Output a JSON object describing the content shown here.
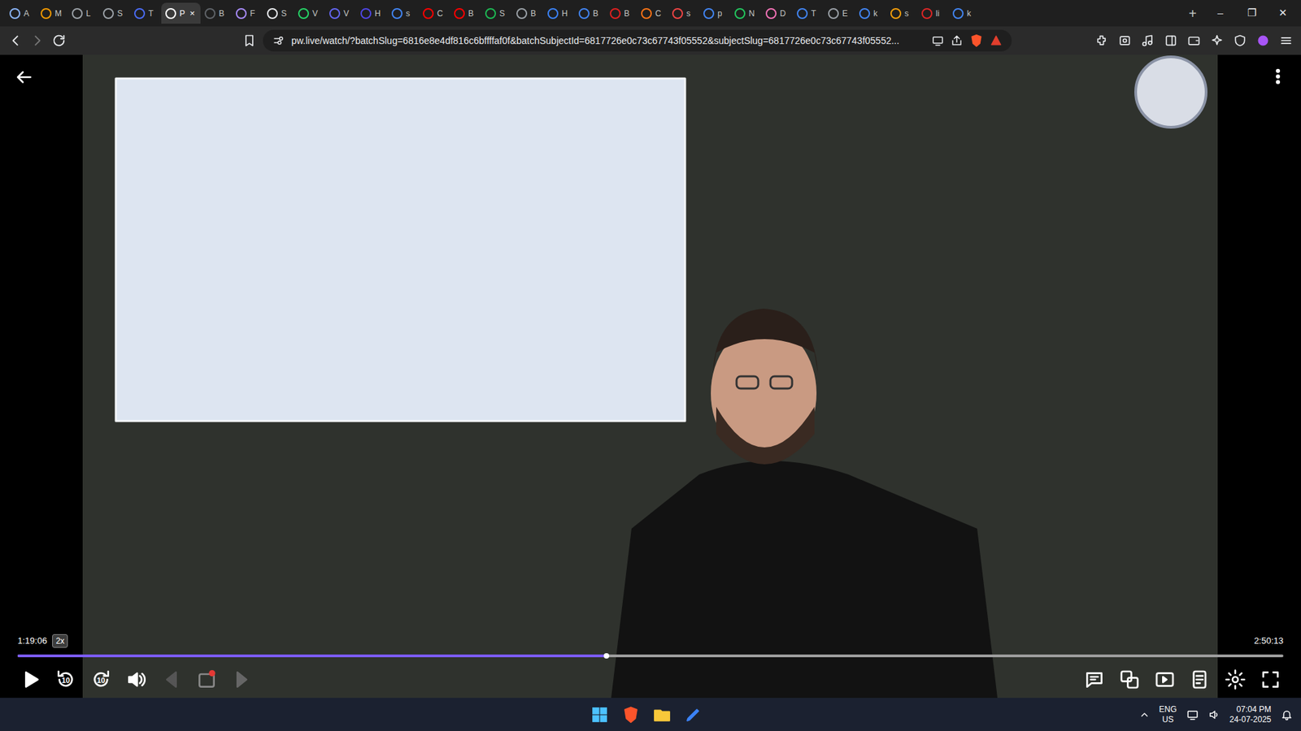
{
  "tabs": [
    {
      "label": "A",
      "selected": false,
      "color": "#8ab4f8"
    },
    {
      "label": "M",
      "selected": false,
      "color": "#f29900"
    },
    {
      "label": "L",
      "selected": false,
      "color": "#9aa0a6"
    },
    {
      "label": "S",
      "selected": false,
      "color": "#9aa0a6"
    },
    {
      "label": "T",
      "selected": false,
      "color": "#4a6cf7"
    },
    {
      "label": "P",
      "selected": true,
      "color": "#ffffff"
    },
    {
      "label": "B",
      "selected": false,
      "color": "#5f6368"
    },
    {
      "label": "F",
      "selected": false,
      "color": "#a78bfa"
    },
    {
      "label": "S",
      "selected": false,
      "color": "#e8eaed"
    },
    {
      "label": "V",
      "selected": false,
      "color": "#25d366"
    },
    {
      "label": "V",
      "selected": false,
      "color": "#6366f1"
    },
    {
      "label": "H",
      "selected": false,
      "color": "#4f46e5"
    },
    {
      "label": "s",
      "selected": false,
      "color": "#4285f4"
    },
    {
      "label": "C",
      "selected": false,
      "color": "#ff0000"
    },
    {
      "label": "B",
      "selected": false,
      "color": "#ff0000"
    },
    {
      "label": "S",
      "selected": false,
      "color": "#1db954"
    },
    {
      "label": "B",
      "selected": false,
      "color": "#9aa0a6"
    },
    {
      "label": "H",
      "selected": false,
      "color": "#3b82f6"
    },
    {
      "label": "B",
      "selected": false,
      "color": "#4285f4"
    },
    {
      "label": "B",
      "selected": false,
      "color": "#e02020"
    },
    {
      "label": "C",
      "selected": false,
      "color": "#f97316"
    },
    {
      "label": "s",
      "selected": false,
      "color": "#ef4444"
    },
    {
      "label": "p",
      "selected": false,
      "color": "#4285f4"
    },
    {
      "label": "N",
      "selected": false,
      "color": "#22c55e"
    },
    {
      "label": "D",
      "selected": false,
      "color": "#f472b6"
    },
    {
      "label": "T",
      "selected": false,
      "color": "#4285f4"
    },
    {
      "label": "E",
      "selected": false,
      "color": "#9aa0a6"
    },
    {
      "label": "k",
      "selected": false,
      "color": "#4285f4"
    },
    {
      "label": "s",
      "selected": false,
      "color": "#f59e0b"
    },
    {
      "label": "li",
      "selected": false,
      "color": "#dc2626"
    },
    {
      "label": "k",
      "selected": false,
      "color": "#4285f4"
    }
  ],
  "tab_close": "×",
  "new_tab": "+",
  "window_controls": [
    "–",
    "❐",
    "✕"
  ],
  "address": {
    "url": "pw.live/watch/?batchSlug=6816e8e4df816c6bffffaf0f&batchSubjectId=6817726e0c73c67743f05552&subjectSlug=6817726e0c73c67743f05552..."
  },
  "player": {
    "current_time": "1:19:06",
    "speed": "2x",
    "duration": "2:50:13",
    "progress": 0.465,
    "playing": false,
    "rewind_label": "10",
    "forward_label": "10"
  },
  "taskbar": {
    "language": "ENG",
    "region": "US",
    "time": "07:04 PM",
    "date": "24-07-2025"
  }
}
